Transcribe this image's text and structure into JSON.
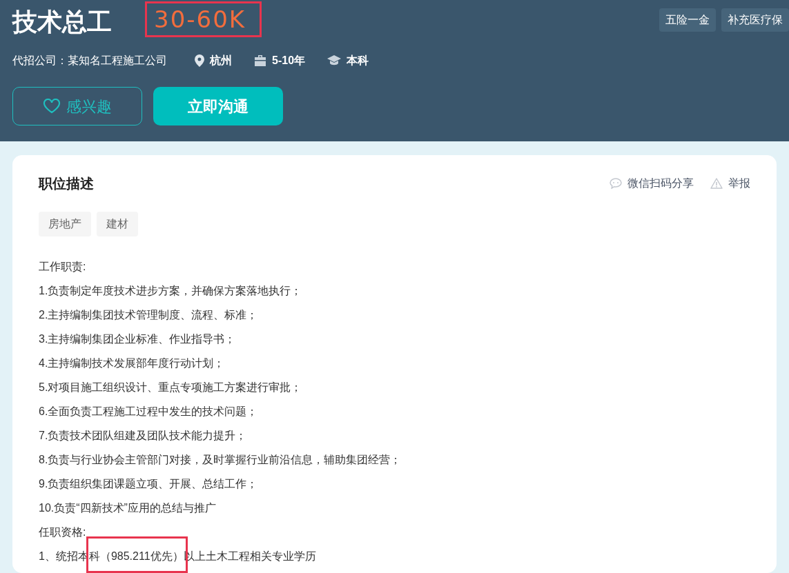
{
  "job": {
    "title": "技术总工",
    "salary": {
      "text": "30-60K",
      "highlighted": true
    },
    "company": "代招公司：某知名工程施工公司",
    "location": "杭州",
    "experience": "5-10年",
    "education": "本科",
    "benefits": [
      "五险一金",
      "补充医疗保"
    ],
    "buttons": [
      {
        "kind": "interest",
        "label": "感兴趣"
      },
      {
        "kind": "chat",
        "label": "立即沟通"
      }
    ]
  },
  "description": {
    "heading": "职位描述",
    "actions": [
      {
        "kind": "share",
        "label": "微信扫码分享"
      },
      {
        "kind": "report",
        "label": "举报"
      }
    ],
    "tags": [
      "房地产",
      "建材"
    ],
    "lines": [
      {
        "text": "工作职责:"
      },
      {
        "text": "1.负责制定年度技术进步方案，并确保方案落地执行；"
      },
      {
        "text": "2.主持编制集团技术管理制度、流程、标准；"
      },
      {
        "text": "3.主持编制集团企业标准、作业指导书；"
      },
      {
        "text": "4.主持编制技术发展部年度行动计划；"
      },
      {
        "text": "5.对项目施工组织设计、重点专项施工方案进行审批；"
      },
      {
        "text": "6.全面负责工程施工过程中发生的技术问题；"
      },
      {
        "text": "7.负责技术团队组建及团队技术能力提升；"
      },
      {
        "text": "8.负责与行业协会主管部门对接，及时掌握行业前沿信息，辅助集团经营；"
      },
      {
        "text": "9.负责组织集团课题立项、开展、总结工作；"
      },
      {
        "text": "10.负责“四新技术”应用的总结与推广"
      },
      {
        "text": "任职资格:"
      },
      {
        "parts": [
          {
            "text": "1、统招本",
            "highlighted": false
          },
          {
            "text": "科（985.211优先）",
            "highlighted": true
          },
          {
            "text": "以上土木工程相关专业学历",
            "highlighted": false
          }
        ]
      }
    ]
  }
}
